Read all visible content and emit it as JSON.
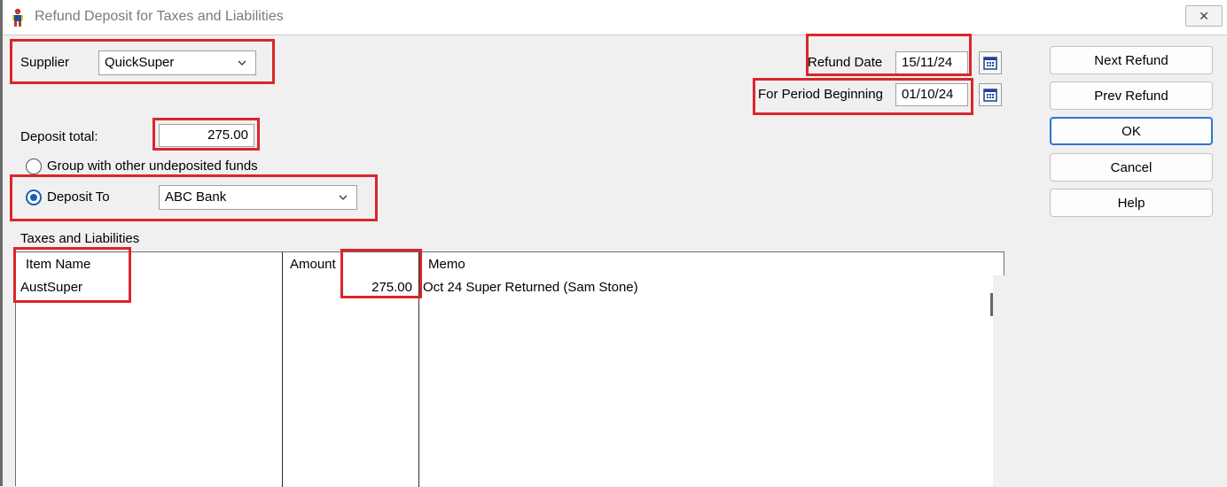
{
  "window": {
    "title": "Refund Deposit for Taxes and Liabilities",
    "close_glyph": "✕",
    "icon": "person-icon"
  },
  "supplier": {
    "label": "Supplier",
    "value": "QuickSuper"
  },
  "refund_date": {
    "label": "Refund Date",
    "value": "15/11/24"
  },
  "period_beginning": {
    "label": "For Period Beginning",
    "value": "01/10/24"
  },
  "deposit_total": {
    "label": "Deposit total:",
    "value": "275.00"
  },
  "options": {
    "group_label": "Group with other undeposited funds",
    "deposit_to_label": "Deposit To",
    "deposit_to_value": "ABC Bank",
    "selected": "deposit_to"
  },
  "buttons": {
    "next_refund": "Next Refund",
    "prev_refund": "Prev Refund",
    "ok": "OK",
    "cancel": "Cancel",
    "help": "Help"
  },
  "table": {
    "section_label": "Taxes and Liabilities",
    "columns": [
      "Item Name",
      "Amount",
      "Memo"
    ],
    "rows": [
      {
        "item_name": "AustSuper",
        "amount": "275.00",
        "memo": "Oct 24 Super Returned (Sam Stone)"
      }
    ]
  },
  "colors": {
    "highlight": "#d9262b",
    "accent": "#1a5fb4"
  }
}
